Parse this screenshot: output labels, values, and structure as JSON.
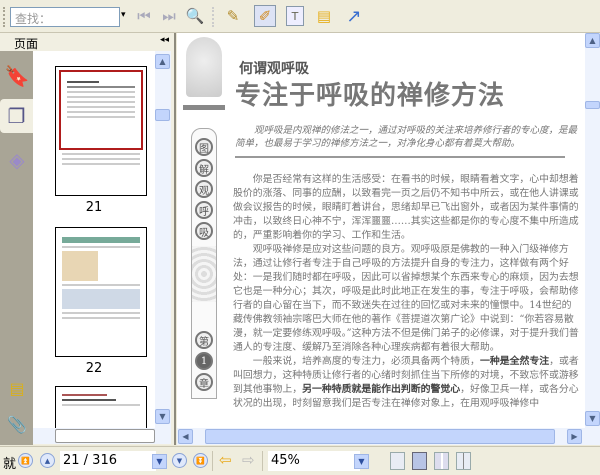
{
  "toolbar": {
    "search_placeholder": "查找：",
    "icons": [
      "prev-result-icon",
      "next-result-icon",
      "search-zoom-icon",
      "highlight-pen-icon",
      "edit-note-icon",
      "text-box-icon",
      "comment-icon",
      "arrow-icon"
    ]
  },
  "left_panel": {
    "title": "页面",
    "collapse": "◂◂",
    "thumbnails": [
      {
        "label": "21"
      },
      {
        "label": "22"
      }
    ]
  },
  "document": {
    "subtitle": "何谓观呼吸",
    "title": "专注于呼吸的禅修方法",
    "intro": "观呼吸是内观禅的修法之一，通过对呼吸的关注来培养修行者的专心度，是最简单，也最易于学习的禅修方法之一，对净化身心都有着莫大帮助。",
    "banner_top": [
      "图",
      "解",
      "观",
      "呼",
      "吸"
    ],
    "banner_chapter": [
      "第",
      "1",
      "章"
    ],
    "p1": "你是否经常有这样的生活感受：在看书的时候，眼睛看着文字，心中却想着股价的涨落、同事的应酬，以致看完一页之后仍不知书中所云，或在他人讲课或做会议报告的时候，眼睛盯着讲台，思绪却早已飞出窗外，或者因为某件事情的冲击，以致终日心神不宁，浑浑噩噩……其实这些都是你的专心度不集中所造成的，严重影响着你的学习、工作和生活。",
    "p2": "观呼吸禅修是应对这些问题的良方。观呼吸原是佛教的一种入门级禅修方法，通过让修行者专注于自己呼吸的方法提升自身的专注力，这样做有两个好处：一是我们随时都在呼吸，因此可以省掉想某个东西来专心的麻烦，因为去想它也是一种分心；其次，呼吸是此时此地正在发生的事，专注于呼吸，会帮助修行者的自心留在当下，而不致迷失在过往的回忆或对未来的憧憬中。14世纪的藏传佛教领袖宗喀巴大师在他的著作《菩提道次第广论》中说到：“你若容易散漫，就一定要修练观呼吸。”这种方法不但是佛门弟子的必修课，对于提升我们普通人的专注度、缓解乃至消除各种心理疾病都有着很大帮助。",
    "p3a": "一般来说，培养高度的专注力，必须具备两个特质，",
    "p3b": "一种是全然专注",
    "p3c": "，或者叫回想力，这种特质让修行者的心绪时刻抓住当下所修的对境，不致忘怀或游移到其他事物上，",
    "p3d": "另一种特质就是能作出判断的警觉心",
    "p3e": "，好像卫兵一样，或各分心状况的出现，时刻留意我们是否专注在禅修对象上，在用观呼吸禅修中"
  },
  "bottom": {
    "find_label": "就",
    "page_value": "21 / 316",
    "zoom_value": "45%"
  }
}
